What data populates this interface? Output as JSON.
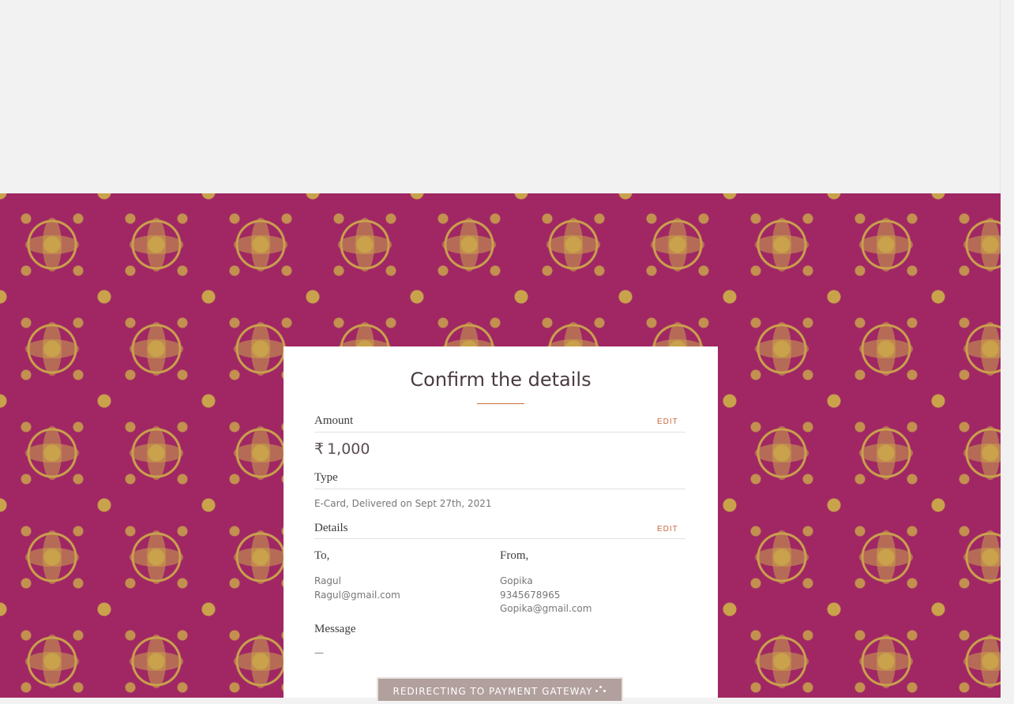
{
  "colors": {
    "pattern_background": "#a02764",
    "pattern_gold": "#c9a24b",
    "accent": "#c96a3c",
    "button_background": "#b1a09d"
  },
  "card": {
    "title": "Confirm the details",
    "amount": {
      "label": "Amount",
      "edit_label": "EDIT",
      "currency_symbol": "₹",
      "value": "1,000"
    },
    "type": {
      "label": "Type",
      "value": "E-Card, Delivered on Sept 27th, 2021"
    },
    "details": {
      "label": "Details",
      "edit_label": "EDIT",
      "to": {
        "heading": "To,",
        "name": "Ragul",
        "email": "Ragul@gmail.com"
      },
      "from": {
        "heading": "From,",
        "name": "Gopika",
        "phone": "9345678965",
        "email": "Gopika@gmail.com"
      }
    },
    "message": {
      "label": "Message",
      "value": "—"
    },
    "submit_button": {
      "label": "REDIRECTING TO PAYMENT GATEWAY",
      "icon": "loading-spinner-icon"
    }
  }
}
